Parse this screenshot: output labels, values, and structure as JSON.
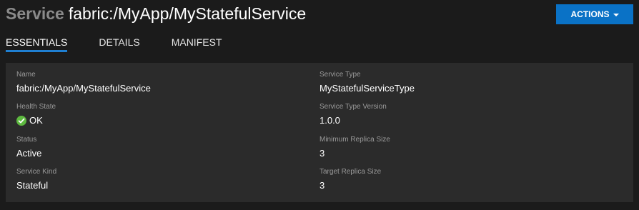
{
  "header": {
    "kind": "Service",
    "name": "fabric:/MyApp/MyStatefulService"
  },
  "actions": {
    "label": "ACTIONS"
  },
  "tabs": [
    {
      "label": "ESSENTIALS",
      "active": true
    },
    {
      "label": "DETAILS",
      "active": false
    },
    {
      "label": "MANIFEST",
      "active": false
    }
  ],
  "essentials": {
    "name": {
      "label": "Name",
      "value": "fabric:/MyApp/MyStatefulService"
    },
    "health_state": {
      "label": "Health State",
      "value": "OK",
      "icon": "ok-icon"
    },
    "status": {
      "label": "Status",
      "value": "Active"
    },
    "service_kind": {
      "label": "Service Kind",
      "value": "Stateful"
    },
    "service_type": {
      "label": "Service Type",
      "value": "MyStatefulServiceType"
    },
    "service_type_version": {
      "label": "Service Type Version",
      "value": "1.0.0"
    },
    "min_replica_size": {
      "label": "Minimum Replica Size",
      "value": "3"
    },
    "target_replica_size": {
      "label": "Target Replica Size",
      "value": "3"
    }
  },
  "colors": {
    "background": "#1b1b1b",
    "panel": "#2b2b2b",
    "accent": "#0a72c6",
    "tab_underline": "#1f7fd1",
    "ok_green": "#5db93f",
    "muted_text": "#9a9a9a"
  }
}
